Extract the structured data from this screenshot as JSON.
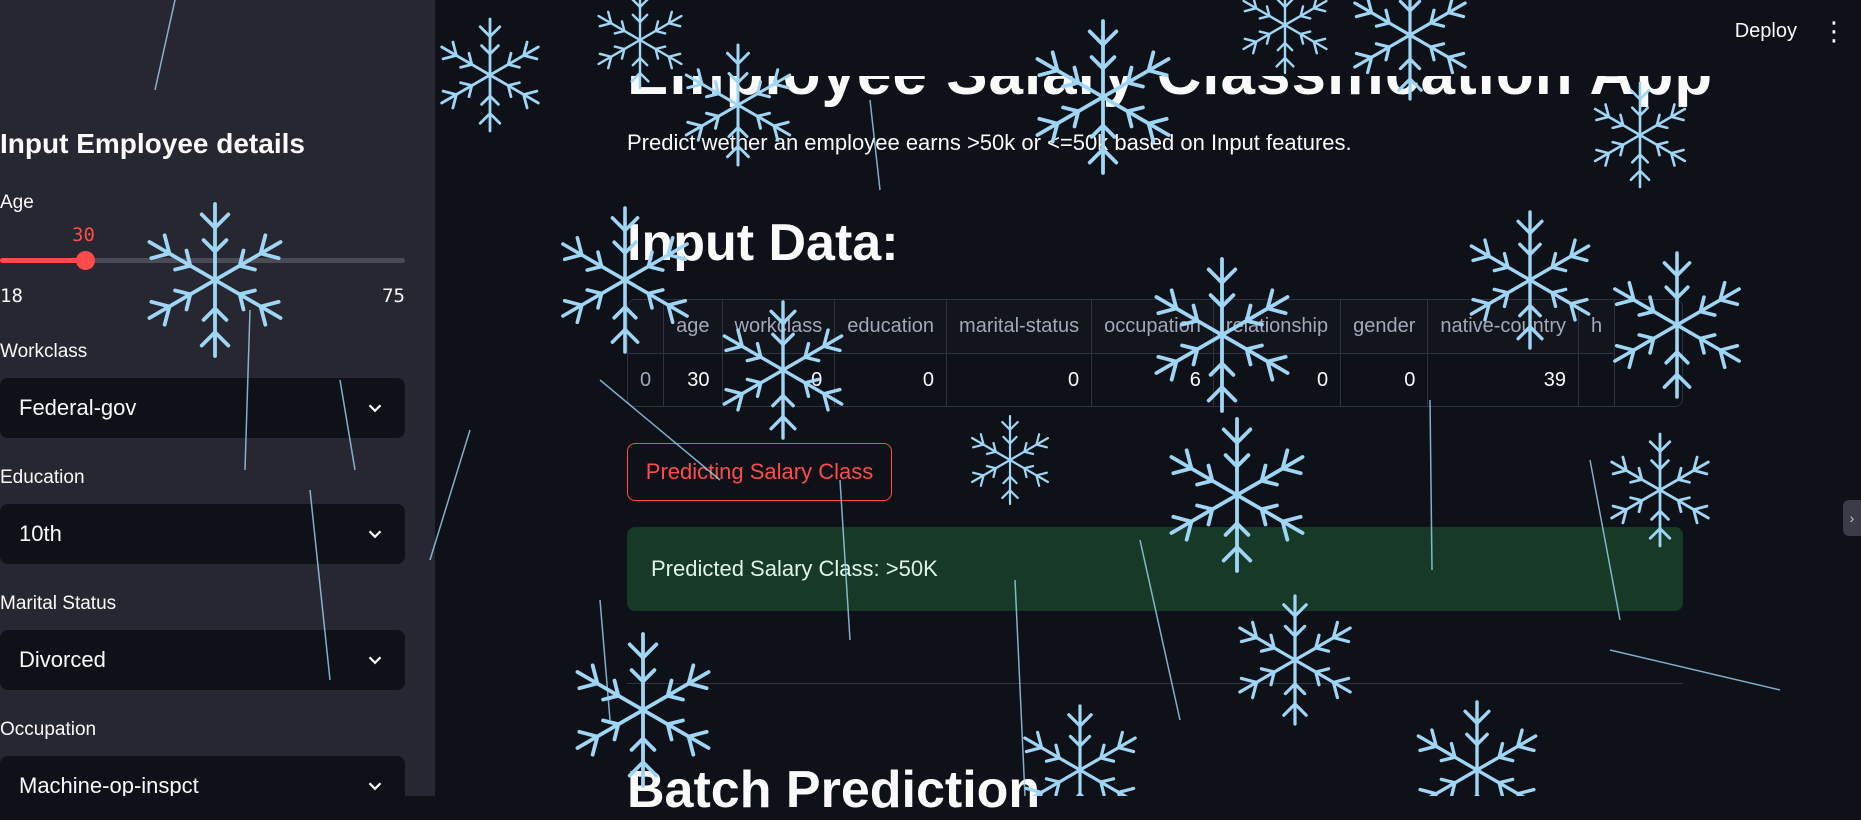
{
  "header": {
    "deploy_label": "Deploy",
    "menu_icon": "kebab-menu-icon"
  },
  "sidebar": {
    "title": "Input Employee details",
    "age": {
      "label": "Age",
      "value": 30,
      "min": 18,
      "max": 75,
      "value_text": "30",
      "min_text": "18",
      "max_text": "75"
    },
    "workclass": {
      "label": "Workclass",
      "value": "Federal-gov"
    },
    "education": {
      "label": "Education",
      "value": "10th"
    },
    "marital_status": {
      "label": "Marital Status",
      "value": "Divorced"
    },
    "occupation": {
      "label": "Occupation",
      "value": "Machine-op-inspct"
    }
  },
  "main": {
    "subtitle": "Predict wether an employee earns >50k or <=50k based on Input features.",
    "input_heading": "Input Data:",
    "table": {
      "columns": [
        "",
        "age",
        "workclass",
        "education",
        "marital-status",
        "occupation",
        "relationship",
        "gender",
        "native-country",
        "h"
      ],
      "rows": [
        [
          "0",
          "30",
          "0",
          "0",
          "0",
          "6",
          "0",
          "0",
          "39",
          ""
        ]
      ]
    },
    "predict_button": "Predicting Salary Class",
    "result_text": "Predicted Salary Class: >50K",
    "batch_heading": "Batch Prediction"
  },
  "colors": {
    "accent": "#ff4b4b",
    "background": "#0e1117",
    "sidebar": "#262730",
    "success_bg": "#173928",
    "snow": "#9fd6f5"
  }
}
